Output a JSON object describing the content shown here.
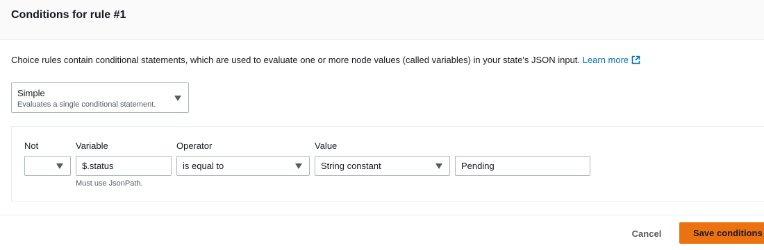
{
  "modal": {
    "title": "Conditions for rule #1",
    "description": "Choice rules contain conditional statements, which are used to evaluate one or more node values (called variables) in your state's JSON input.",
    "learn_more_label": "Learn more"
  },
  "rule_type": {
    "value": "Simple",
    "description": "Evaluates a single conditional statement."
  },
  "condition": {
    "labels": {
      "not": "Not",
      "variable": "Variable",
      "operator": "Operator",
      "value": "Value"
    },
    "not_value": "",
    "variable_value": "$.status",
    "variable_hint": "Must use JsonPath.",
    "operator_value": "is equal to",
    "value_type": "String constant",
    "value_input": "Pending"
  },
  "footer": {
    "cancel_label": "Cancel",
    "save_label": "Save conditions"
  },
  "colors": {
    "primary_button": "#ec7211",
    "link": "#0073bb",
    "border": "#aab7b8"
  },
  "icons": {
    "external_link": "external-link-icon",
    "dropdown": "caret-down-icon"
  }
}
